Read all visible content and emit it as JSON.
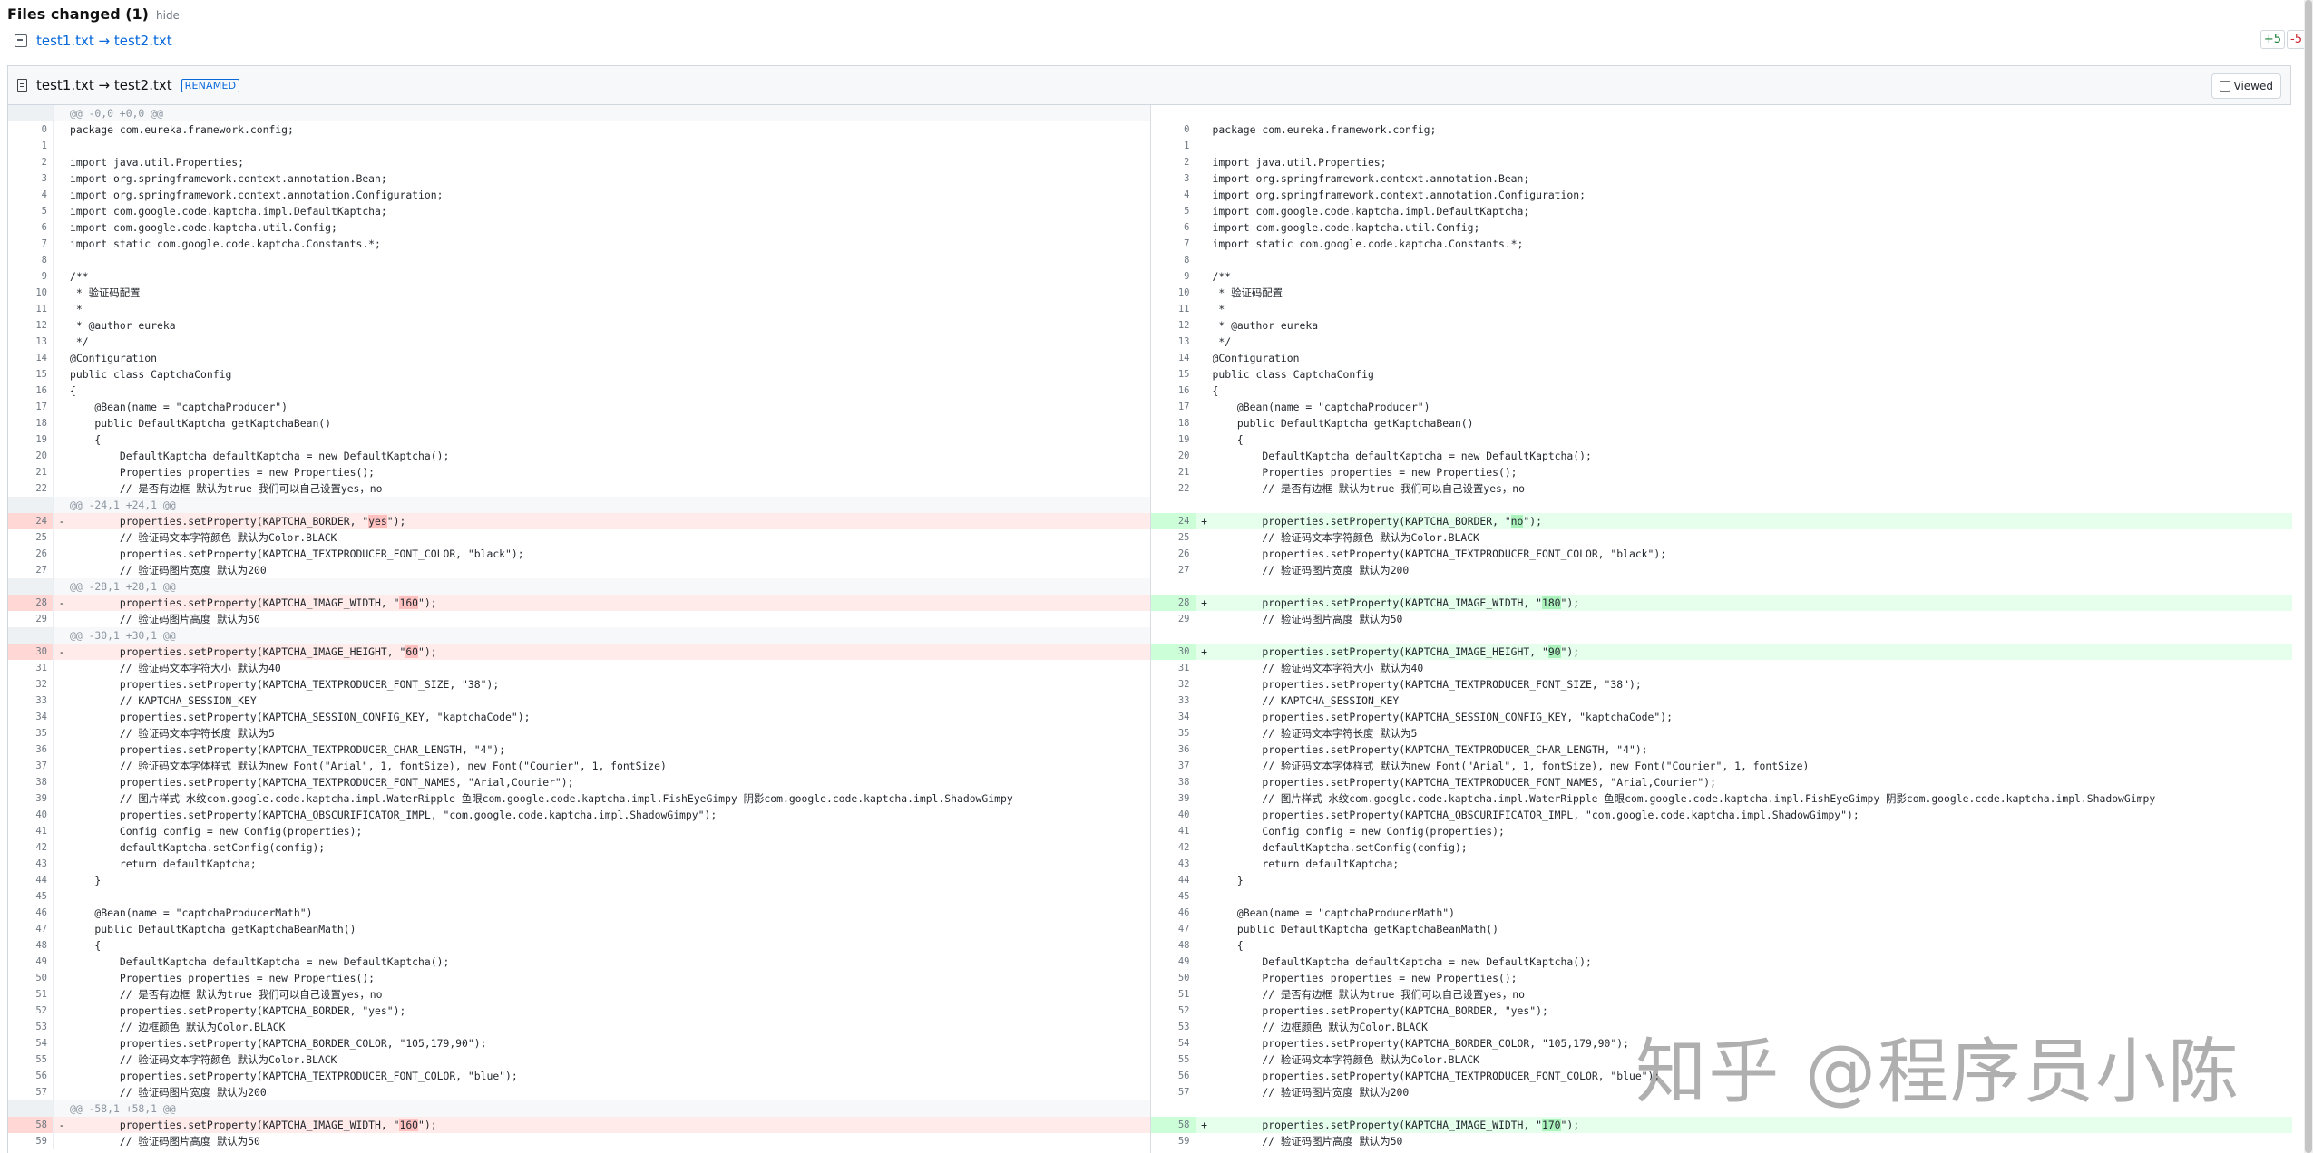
{
  "header": {
    "title": "Files changed (1)",
    "hide_label": "hide"
  },
  "file_link": {
    "label": "test1.txt → test2.txt"
  },
  "stats": {
    "additions": "+5",
    "deletions": "-5"
  },
  "file": {
    "name": "test1.txt → test2.txt",
    "badge": "RENAMED",
    "viewed_label": "Viewed",
    "viewed": false
  },
  "watermark": "知乎 @程序员小陈",
  "left_lines": [
    {
      "t": "hunk",
      "n": "",
      "m": "",
      "c": "@@ -0,0 +0,0 @@"
    },
    {
      "t": "ctx",
      "n": "0",
      "m": "",
      "c": "package com.eureka.framework.config;"
    },
    {
      "t": "ctx",
      "n": "1",
      "m": "",
      "c": ""
    },
    {
      "t": "ctx",
      "n": "2",
      "m": "",
      "c": "import java.util.Properties;"
    },
    {
      "t": "ctx",
      "n": "3",
      "m": "",
      "c": "import org.springframework.context.annotation.Bean;"
    },
    {
      "t": "ctx",
      "n": "4",
      "m": "",
      "c": "import org.springframework.context.annotation.Configuration;"
    },
    {
      "t": "ctx",
      "n": "5",
      "m": "",
      "c": "import com.google.code.kaptcha.impl.DefaultKaptcha;"
    },
    {
      "t": "ctx",
      "n": "6",
      "m": "",
      "c": "import com.google.code.kaptcha.util.Config;"
    },
    {
      "t": "ctx",
      "n": "7",
      "m": "",
      "c": "import static com.google.code.kaptcha.Constants.*;"
    },
    {
      "t": "ctx",
      "n": "8",
      "m": "",
      "c": ""
    },
    {
      "t": "ctx",
      "n": "9",
      "m": "",
      "c": "/**"
    },
    {
      "t": "ctx",
      "n": "10",
      "m": "",
      "c": " * 验证码配置"
    },
    {
      "t": "ctx",
      "n": "11",
      "m": "",
      "c": " *"
    },
    {
      "t": "ctx",
      "n": "12",
      "m": "",
      "c": " * @author eureka"
    },
    {
      "t": "ctx",
      "n": "13",
      "m": "",
      "c": " */"
    },
    {
      "t": "ctx",
      "n": "14",
      "m": "",
      "c": "@Configuration"
    },
    {
      "t": "ctx",
      "n": "15",
      "m": "",
      "c": "public class CaptchaConfig"
    },
    {
      "t": "ctx",
      "n": "16",
      "m": "",
      "c": "{"
    },
    {
      "t": "ctx",
      "n": "17",
      "m": "",
      "c": "    @Bean(name = \"captchaProducer\")"
    },
    {
      "t": "ctx",
      "n": "18",
      "m": "",
      "c": "    public DefaultKaptcha getKaptchaBean()"
    },
    {
      "t": "ctx",
      "n": "19",
      "m": "",
      "c": "    {"
    },
    {
      "t": "ctx",
      "n": "20",
      "m": "",
      "c": "        DefaultKaptcha defaultKaptcha = new DefaultKaptcha();"
    },
    {
      "t": "ctx",
      "n": "21",
      "m": "",
      "c": "        Properties properties = new Properties();"
    },
    {
      "t": "ctx",
      "n": "22",
      "m": "",
      "c": "        // 是否有边框 默认为true 我们可以自己设置yes，no"
    },
    {
      "t": "hunk",
      "n": "",
      "m": "",
      "c": "@@ -24,1 +24,1 @@"
    },
    {
      "t": "del",
      "n": "24",
      "m": "-",
      "c": "        properties.setProperty(KAPTCHA_BORDER, \"",
      "h": "yes",
      "c2": "\");"
    },
    {
      "t": "ctx",
      "n": "25",
      "m": "",
      "c": "        // 验证码文本字符颜色 默认为Color.BLACK"
    },
    {
      "t": "ctx",
      "n": "26",
      "m": "",
      "c": "        properties.setProperty(KAPTCHA_TEXTPRODUCER_FONT_COLOR, \"black\");"
    },
    {
      "t": "ctx",
      "n": "27",
      "m": "",
      "c": "        // 验证码图片宽度 默认为200"
    },
    {
      "t": "hunk",
      "n": "",
      "m": "",
      "c": "@@ -28,1 +28,1 @@"
    },
    {
      "t": "del",
      "n": "28",
      "m": "-",
      "c": "        properties.setProperty(KAPTCHA_IMAGE_WIDTH, \"",
      "h": "160",
      "c2": "\");"
    },
    {
      "t": "ctx",
      "n": "29",
      "m": "",
      "c": "        // 验证码图片高度 默认为50"
    },
    {
      "t": "hunk",
      "n": "",
      "m": "",
      "c": "@@ -30,1 +30,1 @@"
    },
    {
      "t": "del",
      "n": "30",
      "m": "-",
      "c": "        properties.setProperty(KAPTCHA_IMAGE_HEIGHT, \"",
      "h": "60",
      "c2": "\");"
    },
    {
      "t": "ctx",
      "n": "31",
      "m": "",
      "c": "        // 验证码文本字符大小 默认为40"
    },
    {
      "t": "ctx",
      "n": "32",
      "m": "",
      "c": "        properties.setProperty(KAPTCHA_TEXTPRODUCER_FONT_SIZE, \"38\");"
    },
    {
      "t": "ctx",
      "n": "33",
      "m": "",
      "c": "        // KAPTCHA_SESSION_KEY"
    },
    {
      "t": "ctx",
      "n": "34",
      "m": "",
      "c": "        properties.setProperty(KAPTCHA_SESSION_CONFIG_KEY, \"kaptchaCode\");"
    },
    {
      "t": "ctx",
      "n": "35",
      "m": "",
      "c": "        // 验证码文本字符长度 默认为5"
    },
    {
      "t": "ctx",
      "n": "36",
      "m": "",
      "c": "        properties.setProperty(KAPTCHA_TEXTPRODUCER_CHAR_LENGTH, \"4\");"
    },
    {
      "t": "ctx",
      "n": "37",
      "m": "",
      "c": "        // 验证码文本字体样式 默认为new Font(\"Arial\", 1, fontSize), new Font(\"Courier\", 1, fontSize)"
    },
    {
      "t": "ctx",
      "n": "38",
      "m": "",
      "c": "        properties.setProperty(KAPTCHA_TEXTPRODUCER_FONT_NAMES, \"Arial,Courier\");"
    },
    {
      "t": "ctx",
      "n": "39",
      "m": "",
      "c": "        // 图片样式 水纹com.google.code.kaptcha.impl.WaterRipple 鱼眼com.google.code.kaptcha.impl.FishEyeGimpy 阴影com.google.code.kaptcha.impl.ShadowGimpy"
    },
    {
      "t": "ctx",
      "n": "40",
      "m": "",
      "c": "        properties.setProperty(KAPTCHA_OBSCURIFICATOR_IMPL, \"com.google.code.kaptcha.impl.ShadowGimpy\");"
    },
    {
      "t": "ctx",
      "n": "41",
      "m": "",
      "c": "        Config config = new Config(properties);"
    },
    {
      "t": "ctx",
      "n": "42",
      "m": "",
      "c": "        defaultKaptcha.setConfig(config);"
    },
    {
      "t": "ctx",
      "n": "43",
      "m": "",
      "c": "        return defaultKaptcha;"
    },
    {
      "t": "ctx",
      "n": "44",
      "m": "",
      "c": "    }"
    },
    {
      "t": "ctx",
      "n": "45",
      "m": "",
      "c": ""
    },
    {
      "t": "ctx",
      "n": "46",
      "m": "",
      "c": "    @Bean(name = \"captchaProducerMath\")"
    },
    {
      "t": "ctx",
      "n": "47",
      "m": "",
      "c": "    public DefaultKaptcha getKaptchaBeanMath()"
    },
    {
      "t": "ctx",
      "n": "48",
      "m": "",
      "c": "    {"
    },
    {
      "t": "ctx",
      "n": "49",
      "m": "",
      "c": "        DefaultKaptcha defaultKaptcha = new DefaultKaptcha();"
    },
    {
      "t": "ctx",
      "n": "50",
      "m": "",
      "c": "        Properties properties = new Properties();"
    },
    {
      "t": "ctx",
      "n": "51",
      "m": "",
      "c": "        // 是否有边框 默认为true 我们可以自己设置yes，no"
    },
    {
      "t": "ctx",
      "n": "52",
      "m": "",
      "c": "        properties.setProperty(KAPTCHA_BORDER, \"yes\");"
    },
    {
      "t": "ctx",
      "n": "53",
      "m": "",
      "c": "        // 边框颜色 默认为Color.BLACK"
    },
    {
      "t": "ctx",
      "n": "54",
      "m": "",
      "c": "        properties.setProperty(KAPTCHA_BORDER_COLOR, \"105,179,90\");"
    },
    {
      "t": "ctx",
      "n": "55",
      "m": "",
      "c": "        // 验证码文本字符颜色 默认为Color.BLACK"
    },
    {
      "t": "ctx",
      "n": "56",
      "m": "",
      "c": "        properties.setProperty(KAPTCHA_TEXTPRODUCER_FONT_COLOR, \"blue\");"
    },
    {
      "t": "ctx",
      "n": "57",
      "m": "",
      "c": "        // 验证码图片宽度 默认为200"
    },
    {
      "t": "hunk",
      "n": "",
      "m": "",
      "c": "@@ -58,1 +58,1 @@"
    },
    {
      "t": "del",
      "n": "58",
      "m": "-",
      "c": "        properties.setProperty(KAPTCHA_IMAGE_WIDTH, \"",
      "h": "160",
      "c2": "\");"
    },
    {
      "t": "ctx",
      "n": "59",
      "m": "",
      "c": "        // 验证码图片高度 默认为50"
    }
  ],
  "right_lines": [
    {
      "t": "blank",
      "n": "",
      "m": "",
      "c": ""
    },
    {
      "t": "ctx",
      "n": "0",
      "m": "",
      "c": "package com.eureka.framework.config;"
    },
    {
      "t": "ctx",
      "n": "1",
      "m": "",
      "c": ""
    },
    {
      "t": "ctx",
      "n": "2",
      "m": "",
      "c": "import java.util.Properties;"
    },
    {
      "t": "ctx",
      "n": "3",
      "m": "",
      "c": "import org.springframework.context.annotation.Bean;"
    },
    {
      "t": "ctx",
      "n": "4",
      "m": "",
      "c": "import org.springframework.context.annotation.Configuration;"
    },
    {
      "t": "ctx",
      "n": "5",
      "m": "",
      "c": "import com.google.code.kaptcha.impl.DefaultKaptcha;"
    },
    {
      "t": "ctx",
      "n": "6",
      "m": "",
      "c": "import com.google.code.kaptcha.util.Config;"
    },
    {
      "t": "ctx",
      "n": "7",
      "m": "",
      "c": "import static com.google.code.kaptcha.Constants.*;"
    },
    {
      "t": "ctx",
      "n": "8",
      "m": "",
      "c": ""
    },
    {
      "t": "ctx",
      "n": "9",
      "m": "",
      "c": "/**"
    },
    {
      "t": "ctx",
      "n": "10",
      "m": "",
      "c": " * 验证码配置"
    },
    {
      "t": "ctx",
      "n": "11",
      "m": "",
      "c": " *"
    },
    {
      "t": "ctx",
      "n": "12",
      "m": "",
      "c": " * @author eureka"
    },
    {
      "t": "ctx",
      "n": "13",
      "m": "",
      "c": " */"
    },
    {
      "t": "ctx",
      "n": "14",
      "m": "",
      "c": "@Configuration"
    },
    {
      "t": "ctx",
      "n": "15",
      "m": "",
      "c": "public class CaptchaConfig"
    },
    {
      "t": "ctx",
      "n": "16",
      "m": "",
      "c": "{"
    },
    {
      "t": "ctx",
      "n": "17",
      "m": "",
      "c": "    @Bean(name = \"captchaProducer\")"
    },
    {
      "t": "ctx",
      "n": "18",
      "m": "",
      "c": "    public DefaultKaptcha getKaptchaBean()"
    },
    {
      "t": "ctx",
      "n": "19",
      "m": "",
      "c": "    {"
    },
    {
      "t": "ctx",
      "n": "20",
      "m": "",
      "c": "        DefaultKaptcha defaultKaptcha = new DefaultKaptcha();"
    },
    {
      "t": "ctx",
      "n": "21",
      "m": "",
      "c": "        Properties properties = new Properties();"
    },
    {
      "t": "ctx",
      "n": "22",
      "m": "",
      "c": "        // 是否有边框 默认为true 我们可以自己设置yes，no"
    },
    {
      "t": "blank",
      "n": "",
      "m": "",
      "c": ""
    },
    {
      "t": "add",
      "n": "24",
      "m": "+",
      "c": "        properties.setProperty(KAPTCHA_BORDER, \"",
      "h": "no",
      "c2": "\");"
    },
    {
      "t": "ctx",
      "n": "25",
      "m": "",
      "c": "        // 验证码文本字符颜色 默认为Color.BLACK"
    },
    {
      "t": "ctx",
      "n": "26",
      "m": "",
      "c": "        properties.setProperty(KAPTCHA_TEXTPRODUCER_FONT_COLOR, \"black\");"
    },
    {
      "t": "ctx",
      "n": "27",
      "m": "",
      "c": "        // 验证码图片宽度 默认为200"
    },
    {
      "t": "blank",
      "n": "",
      "m": "",
      "c": ""
    },
    {
      "t": "add",
      "n": "28",
      "m": "+",
      "c": "        properties.setProperty(KAPTCHA_IMAGE_WIDTH, \"",
      "h": "180",
      "c2": "\");"
    },
    {
      "t": "ctx",
      "n": "29",
      "m": "",
      "c": "        // 验证码图片高度 默认为50"
    },
    {
      "t": "blank",
      "n": "",
      "m": "",
      "c": ""
    },
    {
      "t": "add",
      "n": "30",
      "m": "+",
      "c": "        properties.setProperty(KAPTCHA_IMAGE_HEIGHT, \"",
      "h": "90",
      "c2": "\");"
    },
    {
      "t": "ctx",
      "n": "31",
      "m": "",
      "c": "        // 验证码文本字符大小 默认为40"
    },
    {
      "t": "ctx",
      "n": "32",
      "m": "",
      "c": "        properties.setProperty(KAPTCHA_TEXTPRODUCER_FONT_SIZE, \"38\");"
    },
    {
      "t": "ctx",
      "n": "33",
      "m": "",
      "c": "        // KAPTCHA_SESSION_KEY"
    },
    {
      "t": "ctx",
      "n": "34",
      "m": "",
      "c": "        properties.setProperty(KAPTCHA_SESSION_CONFIG_KEY, \"kaptchaCode\");"
    },
    {
      "t": "ctx",
      "n": "35",
      "m": "",
      "c": "        // 验证码文本字符长度 默认为5"
    },
    {
      "t": "ctx",
      "n": "36",
      "m": "",
      "c": "        properties.setProperty(KAPTCHA_TEXTPRODUCER_CHAR_LENGTH, \"4\");"
    },
    {
      "t": "ctx",
      "n": "37",
      "m": "",
      "c": "        // 验证码文本字体样式 默认为new Font(\"Arial\", 1, fontSize), new Font(\"Courier\", 1, fontSize)"
    },
    {
      "t": "ctx",
      "n": "38",
      "m": "",
      "c": "        properties.setProperty(KAPTCHA_TEXTPRODUCER_FONT_NAMES, \"Arial,Courier\");"
    },
    {
      "t": "ctx",
      "n": "39",
      "m": "",
      "c": "        // 图片样式 水纹com.google.code.kaptcha.impl.WaterRipple 鱼眼com.google.code.kaptcha.impl.FishEyeGimpy 阴影com.google.code.kaptcha.impl.ShadowGimpy"
    },
    {
      "t": "ctx",
      "n": "40",
      "m": "",
      "c": "        properties.setProperty(KAPTCHA_OBSCURIFICATOR_IMPL, \"com.google.code.kaptcha.impl.ShadowGimpy\");"
    },
    {
      "t": "ctx",
      "n": "41",
      "m": "",
      "c": "        Config config = new Config(properties);"
    },
    {
      "t": "ctx",
      "n": "42",
      "m": "",
      "c": "        defaultKaptcha.setConfig(config);"
    },
    {
      "t": "ctx",
      "n": "43",
      "m": "",
      "c": "        return defaultKaptcha;"
    },
    {
      "t": "ctx",
      "n": "44",
      "m": "",
      "c": "    }"
    },
    {
      "t": "ctx",
      "n": "45",
      "m": "",
      "c": ""
    },
    {
      "t": "ctx",
      "n": "46",
      "m": "",
      "c": "    @Bean(name = \"captchaProducerMath\")"
    },
    {
      "t": "ctx",
      "n": "47",
      "m": "",
      "c": "    public DefaultKaptcha getKaptchaBeanMath()"
    },
    {
      "t": "ctx",
      "n": "48",
      "m": "",
      "c": "    {"
    },
    {
      "t": "ctx",
      "n": "49",
      "m": "",
      "c": "        DefaultKaptcha defaultKaptcha = new DefaultKaptcha();"
    },
    {
      "t": "ctx",
      "n": "50",
      "m": "",
      "c": "        Properties properties = new Properties();"
    },
    {
      "t": "ctx",
      "n": "51",
      "m": "",
      "c": "        // 是否有边框 默认为true 我们可以自己设置yes，no"
    },
    {
      "t": "ctx",
      "n": "52",
      "m": "",
      "c": "        properties.setProperty(KAPTCHA_BORDER, \"yes\");"
    },
    {
      "t": "ctx",
      "n": "53",
      "m": "",
      "c": "        // 边框颜色 默认为Color.BLACK"
    },
    {
      "t": "ctx",
      "n": "54",
      "m": "",
      "c": "        properties.setProperty(KAPTCHA_BORDER_COLOR, \"105,179,90\");"
    },
    {
      "t": "ctx",
      "n": "55",
      "m": "",
      "c": "        // 验证码文本字符颜色 默认为Color.BLACK"
    },
    {
      "t": "ctx",
      "n": "56",
      "m": "",
      "c": "        properties.setProperty(KAPTCHA_TEXTPRODUCER_FONT_COLOR, \"blue\");"
    },
    {
      "t": "ctx",
      "n": "57",
      "m": "",
      "c": "        // 验证码图片宽度 默认为200"
    },
    {
      "t": "blank",
      "n": "",
      "m": "",
      "c": ""
    },
    {
      "t": "add",
      "n": "58",
      "m": "+",
      "c": "        properties.setProperty(KAPTCHA_IMAGE_WIDTH, \"",
      "h": "170",
      "c2": "\");"
    },
    {
      "t": "ctx",
      "n": "59",
      "m": "",
      "c": "        // 验证码图片高度 默认为50"
    }
  ]
}
